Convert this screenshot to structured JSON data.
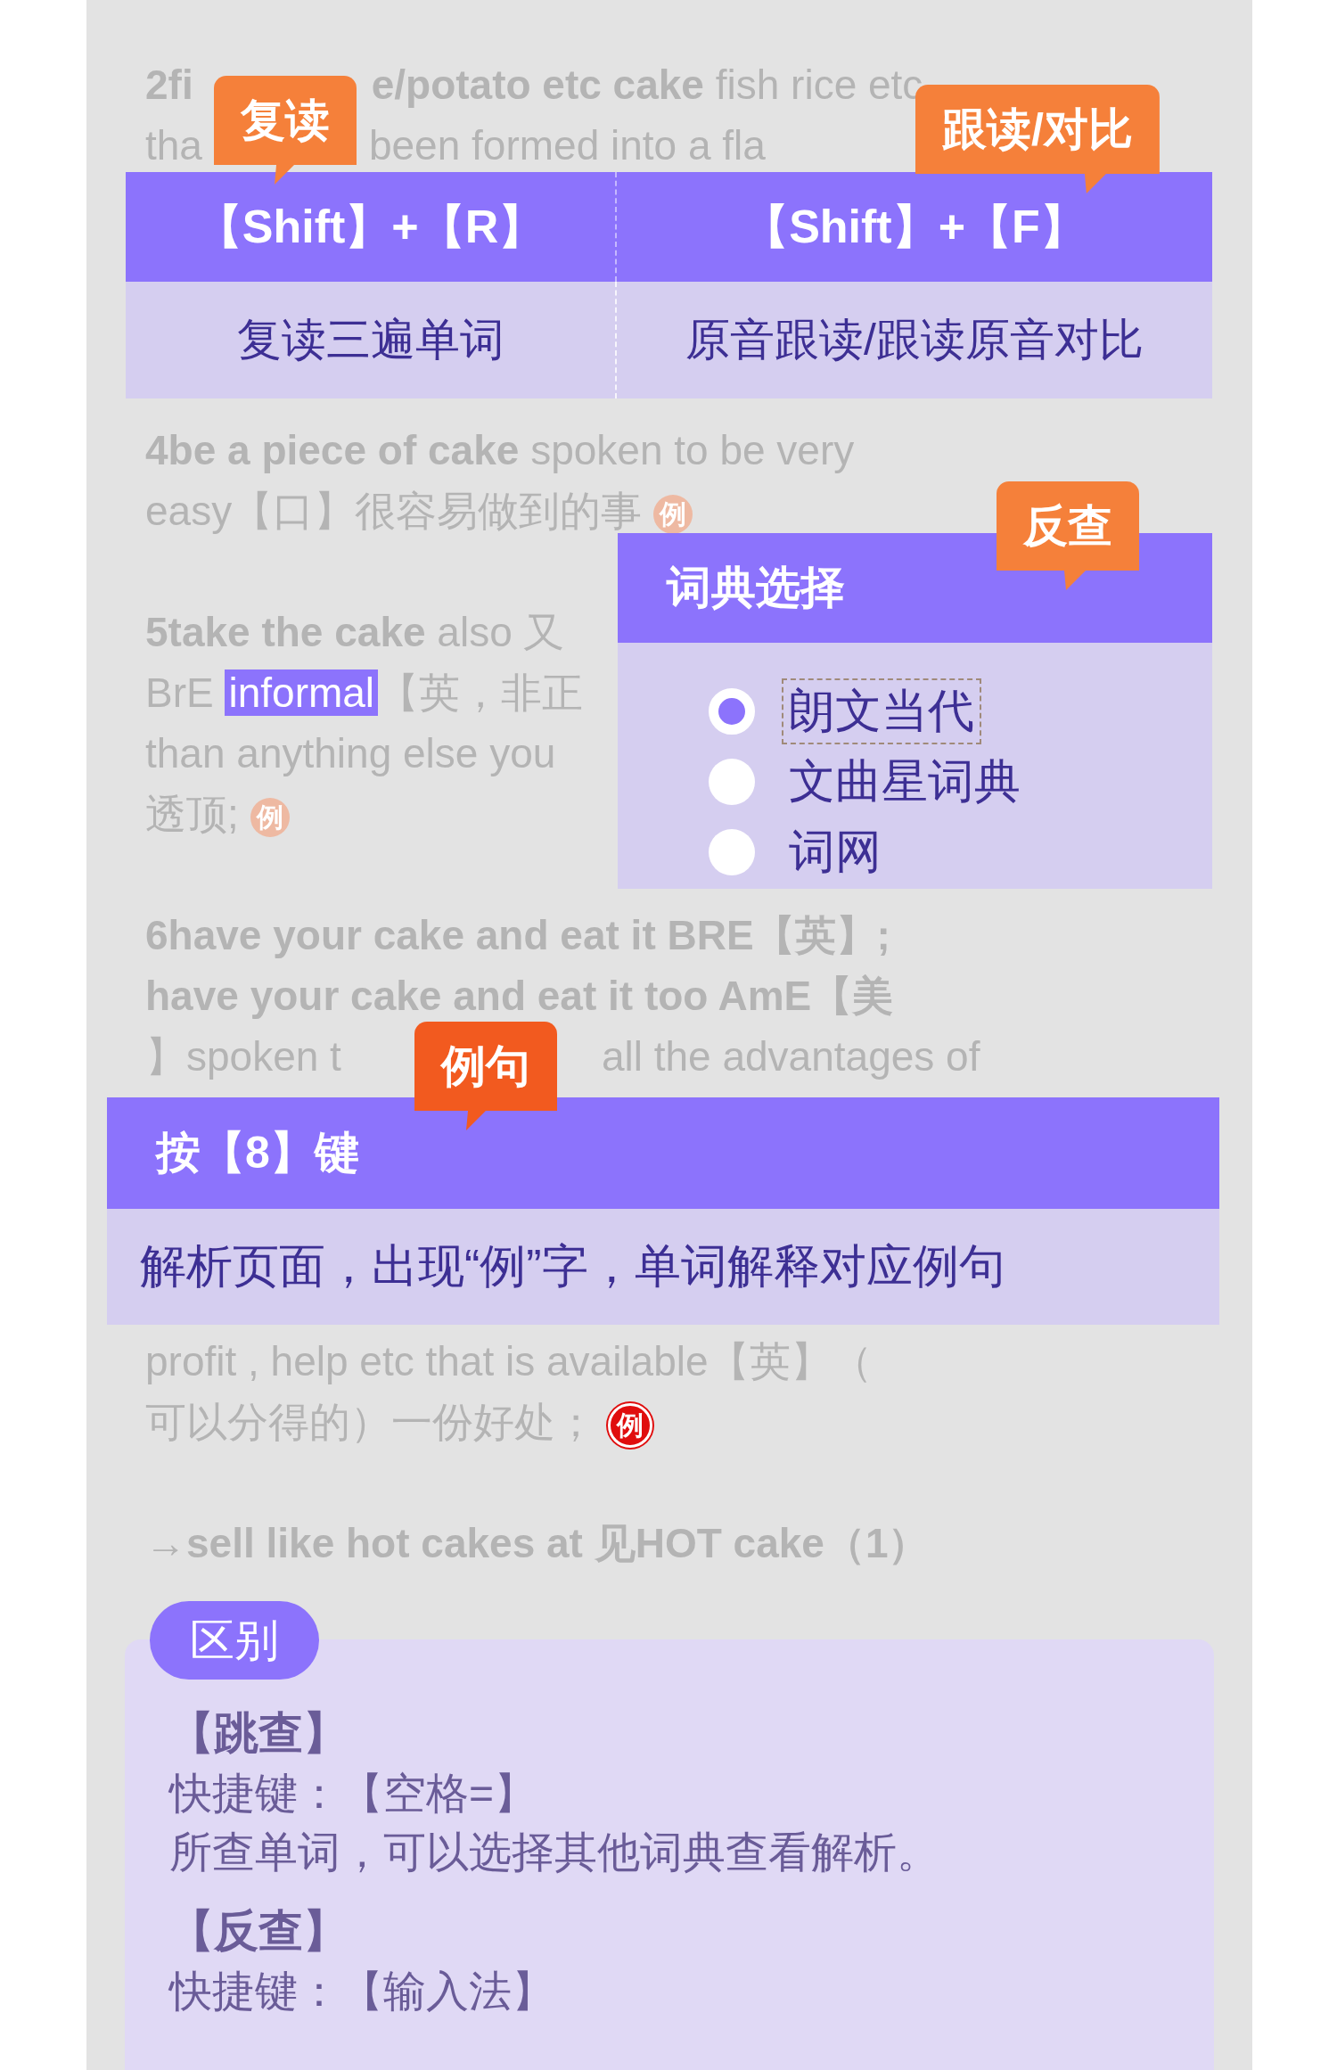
{
  "entries": [
    {
      "lines": [
        [
          {
            "kind": "bold",
            "text": "2fi"
          },
          {
            "kind": "bold",
            "text": "e/potato etc cake"
          },
          {
            "kind": "plain",
            "text": " fish rice etc"
          }
        ],
        [
          {
            "kind": "plain",
            "text": "tha"
          },
          {
            "kind": "plain",
            "text": "been formed into a fla"
          }
        ]
      ]
    },
    {
      "lines": [
        [
          {
            "kind": "bold",
            "text": "4be a piece of cake"
          },
          {
            "kind": "plain",
            "text": " spoken to be very"
          }
        ],
        [
          {
            "kind": "plain",
            "text": "easy【口】很容易做到的事 "
          },
          {
            "kind": "example",
            "text": "例",
            "highlighted": false
          }
        ]
      ]
    },
    {
      "lines": [
        [
          {
            "kind": "bold",
            "text": "5take the cake"
          },
          {
            "kind": "plain",
            "text": " also 又"
          }
        ],
        [
          {
            "kind": "plain",
            "text": "BrE "
          },
          {
            "kind": "highlight",
            "text": "informal"
          },
          {
            "kind": "plain",
            "text": "【英，非正"
          }
        ],
        [
          {
            "kind": "plain",
            "text": "than anything else you"
          }
        ],
        [
          {
            "kind": "plain",
            "text": "透顶; "
          },
          {
            "kind": "example",
            "text": "例",
            "highlighted": false
          }
        ]
      ]
    },
    {
      "lines": [
        [
          {
            "kind": "bold",
            "text": "6have your cake and eat it BRE【英】;"
          }
        ],
        [
          {
            "kind": "bold",
            "text": "have your cake and eat it too AmE【美"
          }
        ],
        [
          {
            "kind": "plain",
            "text": "】spoken t"
          },
          {
            "kind": "plain",
            "text": "all the advantages of"
          }
        ]
      ]
    },
    {
      "lines": [
        [
          {
            "kind": "plain",
            "text": "profit , help etc that is available【英】（"
          }
        ],
        [
          {
            "kind": "plain",
            "text": "可以分得的）一份好处； "
          },
          {
            "kind": "example",
            "text": "例",
            "highlighted": true
          }
        ]
      ]
    },
    {
      "lines": [
        [
          {
            "kind": "bold",
            "text": "→sell like hot cakes at 见HOT cake（1）"
          }
        ]
      ]
    }
  ],
  "shortcut_panel": {
    "columns": [
      {
        "key": "【Shift】+【R】",
        "description": "复读三遍单词"
      },
      {
        "key": "【Shift】+【F】",
        "description": "原音跟读/跟读原音对比"
      }
    ]
  },
  "dictionary_panel": {
    "title": "词典选择",
    "options": [
      {
        "label": "朗文当代",
        "selected": true
      },
      {
        "label": "文曲星词典",
        "selected": false
      },
      {
        "label": "词网",
        "selected": false
      }
    ]
  },
  "example_panel": {
    "title": "按【8】键",
    "description": "解析页面，出现“例”字，单词解释对应例句"
  },
  "tags": [
    {
      "text": "复读",
      "color": "#f5803a"
    },
    {
      "text": "跟读/对比",
      "color": "#f5803a"
    },
    {
      "text": "反查",
      "color": "#f5803a"
    },
    {
      "text": "例句",
      "color": "#f25a1f"
    }
  ],
  "difference_card": {
    "badge": "区别",
    "sections": [
      {
        "heading": "【跳查】",
        "shortcut": "快捷键：【空格=】",
        "description": "所查单词，可以选择其他词典查看解析。"
      },
      {
        "heading": "【反查】",
        "shortcut": "快捷键：【输入法】"
      }
    ]
  }
}
